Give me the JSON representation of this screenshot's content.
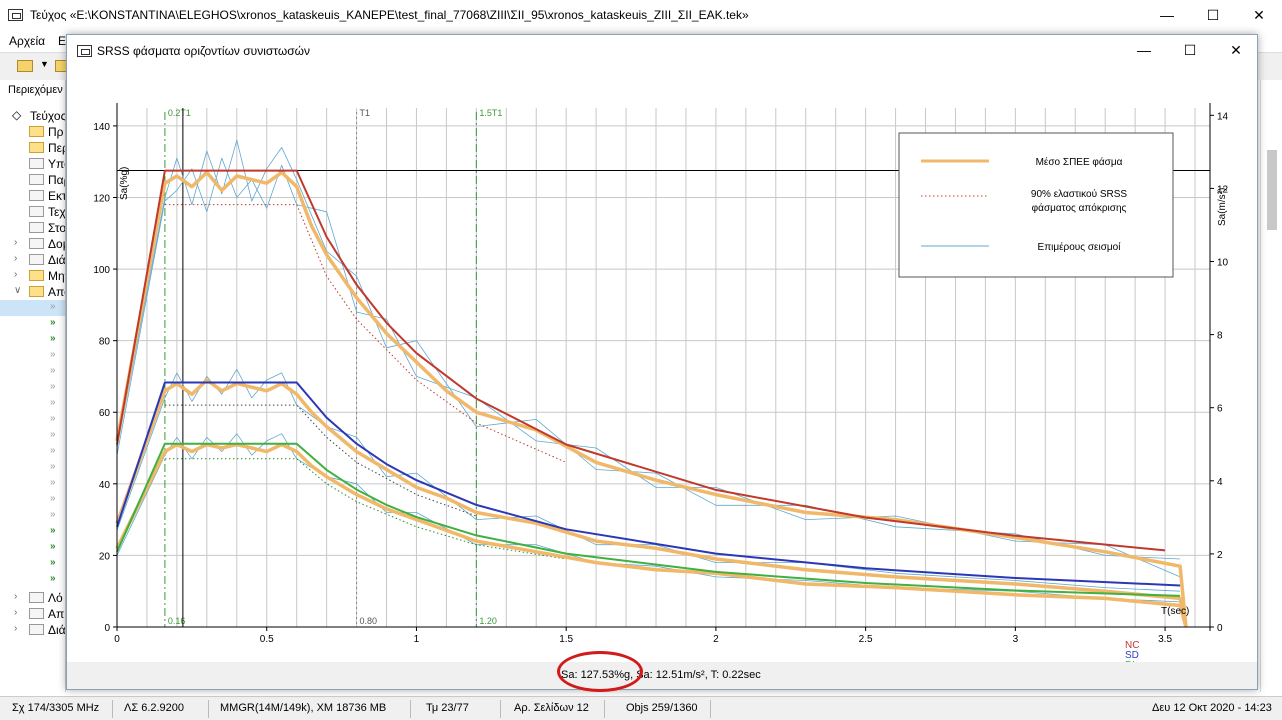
{
  "app": {
    "title": "Τεύχος «E:\\KONSTANTINA\\ELEGHOS\\xronos_kataskeuis_KANEPE\\test_final_77068\\ZIII\\ΣΙΙ_95\\xronos_kataskeuis_ZIII_ΣΙΙ_EAK.tek»",
    "menu": [
      "Αρχεία",
      "E"
    ],
    "tree_header": "Περιεχόμεν",
    "tree": [
      {
        "label": "Τεύχος",
        "kind": "root"
      },
      {
        "label": "Πρ",
        "kind": "folder-yellow"
      },
      {
        "label": "Περ",
        "kind": "folder-yellow"
      },
      {
        "label": "Υπο",
        "kind": "folder-grey"
      },
      {
        "label": "Παρ",
        "kind": "folder-grey"
      },
      {
        "label": "Εκτ",
        "kind": "folder-grey"
      },
      {
        "label": "Τεχ",
        "kind": "folder-grey"
      },
      {
        "label": "Στο",
        "kind": "folder-grey"
      },
      {
        "label": "Δομ",
        "kind": "folder-grey-exp"
      },
      {
        "label": "Διά",
        "kind": "folder-grey-exp"
      },
      {
        "label": "Μητ",
        "kind": "folder-yellow-exp"
      },
      {
        "label": "Απο",
        "kind": "folder-open"
      }
    ],
    "tree_bottom": [
      "Λό",
      "Απ",
      "Διά"
    ]
  },
  "status": {
    "cpu": "Σχ 174/3305 MHz",
    "version": "ΛΣ 6.2.9200",
    "memory": "MMGR(14M/149k), XM 18736 MB",
    "tm": "Τμ 23/77",
    "pages": "Αρ. Σελίδων 12",
    "objs": "Objs 259/1360",
    "datetime": "Δευ 12 Οκτ 2020 - 14:23"
  },
  "dialog": {
    "title": "SRSS φάσματα οριζοντίων συνιστωσών",
    "readout": "Sa: 127.53%g, Sa: 12.51m/s², T: 0.22sec"
  },
  "chart_data": {
    "type": "line",
    "xlabel": "T(sec)",
    "ylabel_left": "Sa(%g)",
    "ylabel_right": "Sa(m/s²)",
    "xlim": [
      0,
      3.65
    ],
    "ylim_left": [
      0,
      145
    ],
    "ylim_right": [
      0,
      14.2
    ],
    "x_ticks": [
      "0",
      "0.5",
      "1",
      "1.5",
      "2",
      "2.5",
      "3",
      "3.5"
    ],
    "x_tick_values": [
      0,
      0.5,
      1,
      1.5,
      2,
      2.5,
      3,
      3.5
    ],
    "y_ticks_left": [
      0,
      20,
      40,
      60,
      80,
      100,
      120,
      140
    ],
    "y_ticks_right": [
      0,
      2,
      4,
      6,
      8,
      10,
      12,
      14
    ],
    "grid": true,
    "vertical_markers": [
      {
        "x": 0.16,
        "top_label": "0.2T1",
        "bottom_label": "0.16",
        "color": "#3a9a3a",
        "style": "dashdot"
      },
      {
        "x": 0.8,
        "top_label": "T1",
        "bottom_label": "0.80",
        "color": "#888888",
        "style": "dotted"
      },
      {
        "x": 1.2,
        "top_label": "1.5T1",
        "bottom_label": "1.20",
        "color": "#3a9a3a",
        "style": "dashdot"
      }
    ],
    "cursor": {
      "x": 0.22,
      "y": 127.53
    },
    "legend": {
      "position": "top-right",
      "items": [
        {
          "label": "Μέσο ΣΠΕΕ φάσμα",
          "color": "#f0b868",
          "style": "solid"
        },
        {
          "label": "90% ελαστικού SRSS φάσματος απόκρισης",
          "color": "#c0392b",
          "style": "dotted"
        },
        {
          "label": "Επιμέρους σεισμοί",
          "color": "#5ea8d0",
          "style": "solid"
        }
      ]
    },
    "limit_labels": [
      {
        "label": "NC",
        "color": "#c0392b"
      },
      {
        "label": "SD",
        "color": "#3040c0"
      },
      {
        "label": "DL",
        "color": "#40b040"
      }
    ],
    "series": [
      {
        "name": "NC",
        "color": "#c0392b",
        "x": [
          0,
          0.16,
          0.6,
          0.7,
          0.8,
          0.9,
          1.0,
          1.2,
          1.5,
          2.0,
          2.5,
          3.0,
          3.5
        ],
        "y": [
          51,
          127.5,
          127.5,
          109,
          95.6,
          85,
          76.5,
          63.8,
          51,
          38.3,
          30.6,
          25.5,
          21.4
        ]
      },
      {
        "name": "SD",
        "color": "#2a38b8",
        "x": [
          0,
          0.16,
          0.6,
          0.7,
          0.8,
          0.9,
          1.0,
          1.2,
          1.5,
          2.0,
          2.5,
          3.0,
          3.55
        ],
        "y": [
          28,
          68.3,
          68.3,
          58.5,
          51.2,
          45.5,
          41,
          34.1,
          27.3,
          20.5,
          16.4,
          13.7,
          11.6
        ]
      },
      {
        "name": "DL",
        "color": "#40b040",
        "x": [
          0,
          0.16,
          0.6,
          0.7,
          0.8,
          0.9,
          1.0,
          1.2,
          1.5,
          2.0,
          2.5,
          3.0,
          3.55
        ],
        "y": [
          21,
          51.2,
          51.2,
          43.9,
          38.4,
          34.1,
          30.7,
          25.6,
          20.5,
          15.4,
          12.3,
          10.2,
          8.7
        ]
      },
      {
        "name": "Μέσο ΣΠΕΕ φάσμα NC",
        "color": "#f0b868",
        "x": [
          0,
          0.16,
          0.2,
          0.25,
          0.3,
          0.35,
          0.4,
          0.45,
          0.5,
          0.55,
          0.6,
          0.65,
          0.7,
          0.8,
          0.9,
          1.0,
          1.1,
          1.2,
          1.4,
          1.6,
          1.8,
          2.0,
          2.3,
          2.6,
          3.0,
          3.3,
          3.55,
          3.57
        ],
        "y": [
          52,
          124,
          126,
          123,
          127,
          122,
          126,
          125,
          124,
          127,
          123,
          112,
          104,
          92,
          82,
          74,
          66,
          60,
          55,
          46,
          41,
          37,
          32,
          30,
          25,
          21,
          17,
          0
        ]
      },
      {
        "name": "Μέσο ΣΠΕΕ φάσμα SD",
        "color": "#f0b868",
        "x": [
          0,
          0.16,
          0.2,
          0.25,
          0.3,
          0.35,
          0.4,
          0.45,
          0.5,
          0.55,
          0.6,
          0.65,
          0.7,
          0.8,
          0.9,
          1.0,
          1.1,
          1.2,
          1.4,
          1.6,
          1.8,
          2.0,
          2.3,
          2.6,
          3.0,
          3.3,
          3.55,
          3.57
        ],
        "y": [
          29,
          66,
          68,
          65,
          69,
          66,
          68,
          67,
          66,
          68,
          65,
          60,
          56,
          49,
          44,
          39,
          36,
          32,
          29,
          24,
          22,
          19,
          16,
          14,
          12,
          10,
          8,
          0
        ]
      },
      {
        "name": "Μέσο ΣΠΕΕ φάσμα DL",
        "color": "#f0b868",
        "x": [
          0,
          0.16,
          0.2,
          0.25,
          0.3,
          0.35,
          0.4,
          0.45,
          0.5,
          0.55,
          0.6,
          0.65,
          0.7,
          0.8,
          0.9,
          1.0,
          1.1,
          1.2,
          1.4,
          1.6,
          1.8,
          2.0,
          2.3,
          2.6,
          3.0,
          3.3,
          3.55,
          3.57
        ],
        "y": [
          22,
          49,
          51,
          49,
          51,
          50,
          51,
          50,
          49,
          51,
          49,
          45,
          42,
          37,
          33,
          30,
          27,
          24,
          21,
          18,
          16,
          15,
          12,
          11,
          9,
          8,
          6,
          0
        ]
      },
      {
        "name": "90% NC",
        "color": "#c0392b",
        "style": "dotted",
        "x": [
          0.16,
          0.6,
          0.7,
          0.8,
          1.0,
          1.2,
          1.5
        ],
        "y": [
          118,
          118,
          98,
          86,
          69,
          57,
          46
        ]
      },
      {
        "name": "90% SD",
        "color": "#444444",
        "style": "dotted",
        "x": [
          0.16,
          0.6,
          0.7,
          0.8,
          1.0,
          1.2
        ],
        "y": [
          62,
          62,
          53,
          46,
          37,
          31
        ]
      },
      {
        "name": "90% DL",
        "color": "#2a8a2a",
        "style": "dotted",
        "x": [
          0.16,
          0.6,
          0.7,
          0.8,
          1.0,
          1.2,
          1.5
        ],
        "y": [
          47,
          47,
          40,
          35,
          28,
          23,
          19
        ]
      },
      {
        "name": "Επιμέρους σεισμοί 1",
        "color": "#5ea8d0",
        "x": [
          0,
          0.16,
          0.2,
          0.25,
          0.3,
          0.35,
          0.4,
          0.45,
          0.5,
          0.55,
          0.6,
          0.7,
          0.8,
          0.9,
          1.0,
          1.2,
          1.4,
          1.6,
          1.8,
          2.0,
          2.3,
          2.6,
          3.0,
          3.3,
          3.55
        ],
        "y": [
          50,
          120,
          131,
          118,
          133,
          121,
          136,
          119,
          128,
          134,
          125,
          105,
          98,
          78,
          80,
          56,
          58,
          44,
          43,
          34,
          34,
          28,
          26,
          20,
          19
        ]
      },
      {
        "name": "Επιμέρους σεισμοί 2",
        "color": "#5ea8d0",
        "x": [
          0,
          0.16,
          0.2,
          0.25,
          0.3,
          0.35,
          0.4,
          0.45,
          0.5,
          0.55,
          0.6,
          0.7,
          0.8,
          0.9,
          1.0,
          1.2,
          1.4,
          1.6,
          1.8,
          2.0,
          2.3,
          2.6,
          3.0,
          3.3,
          3.55
        ],
        "y": [
          48,
          119,
          122,
          128,
          116,
          131,
          120,
          125,
          117,
          129,
          118,
          116,
          88,
          86,
          70,
          64,
          52,
          50,
          39,
          39,
          30,
          31,
          24,
          23,
          14
        ]
      },
      {
        "name": "Επιμέρους σεισμοί 3",
        "color": "#5ea8d0",
        "x": [
          0,
          0.16,
          0.2,
          0.25,
          0.3,
          0.35,
          0.4,
          0.45,
          0.5,
          0.55,
          0.6,
          0.7,
          0.8,
          0.9,
          1.0,
          1.2,
          1.4,
          1.6,
          1.8,
          2.0,
          2.3,
          2.6,
          3.0,
          3.3,
          3.55
        ],
        "y": [
          27,
          64,
          71,
          63,
          70,
          65,
          72,
          64,
          69,
          71,
          62,
          56,
          53,
          42,
          43,
          30,
          31,
          23,
          23,
          18,
          18,
          15,
          13,
          11,
          10
        ]
      },
      {
        "name": "Επιμέρους σεισμοί 4",
        "color": "#5ea8d0",
        "x": [
          0,
          0.16,
          0.2,
          0.25,
          0.3,
          0.35,
          0.4,
          0.45,
          0.5,
          0.55,
          0.6,
          0.7,
          0.8,
          0.9,
          1.0,
          1.2,
          1.4,
          1.6,
          1.8,
          2.0,
          2.3,
          2.6,
          3.0,
          3.3,
          3.55
        ],
        "y": [
          20,
          48,
          53,
          47,
          53,
          49,
          54,
          48,
          52,
          54,
          47,
          42,
          40,
          32,
          32,
          23,
          23,
          18,
          17,
          14,
          13,
          11,
          10,
          8,
          7
        ]
      }
    ]
  }
}
